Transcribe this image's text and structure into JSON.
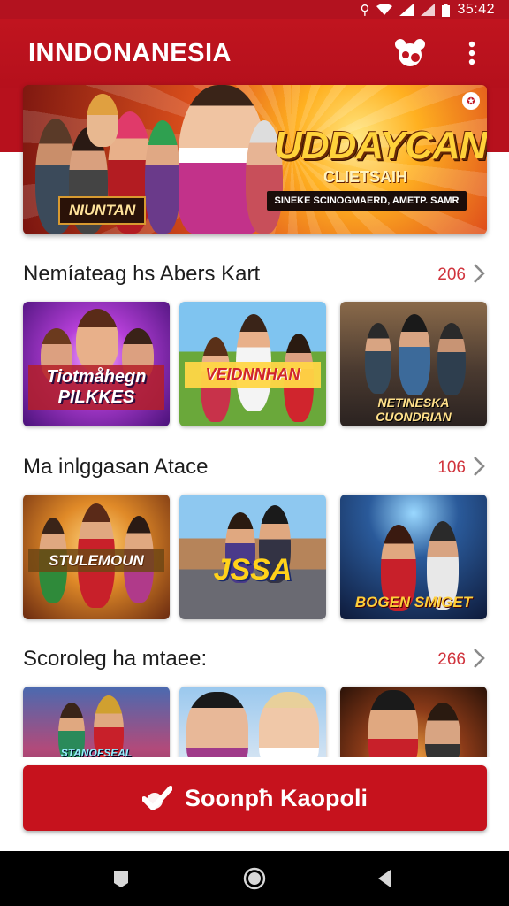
{
  "status_bar": {
    "time": "35:42",
    "icons": [
      "usb-icon",
      "wifi-icon",
      "signal-icon",
      "signal-icon",
      "battery-icon"
    ]
  },
  "app_bar": {
    "title": "INNDONANESIA",
    "icons": [
      "community-icon",
      "more-vert-icon"
    ]
  },
  "banner": {
    "title": "UDDAYCAN",
    "subtitle": "CLIETSAIH",
    "ribbon_text": "SINEKE SCINOGMAERD, AMETP. SAMR",
    "left_label": "NIUNTAN"
  },
  "sections": [
    {
      "title": "Nemíateag hs Abers Kart",
      "count": "206",
      "cards": [
        {
          "label": "Tiotmåhegn PILKKES"
        },
        {
          "label": "VEIDNNHAN"
        },
        {
          "label": "NETINESKA CUONDRIAN"
        }
      ]
    },
    {
      "title": "Ma inlggasan Atace",
      "count": "106",
      "cards": [
        {
          "label": "STULEMOUN"
        },
        {
          "label": "JSSA"
        },
        {
          "label": "BOGEN SMIGET"
        }
      ]
    },
    {
      "title": "Scoroleg ha mtaee:",
      "count": "266",
      "cards": [
        {
          "label": "STANOFSEAL"
        },
        {
          "label": ""
        },
        {
          "label": ""
        }
      ]
    }
  ],
  "bottom_button": {
    "label": "Soonpħ Kaopoli",
    "icon": "check-icon"
  },
  "nav_bar": {
    "icons": [
      "recents-icon",
      "home-icon",
      "back-icon"
    ]
  },
  "colors": {
    "brand_red": "#c6121d",
    "count_red": "#d0333c",
    "text_dark": "#1d1d1d"
  }
}
